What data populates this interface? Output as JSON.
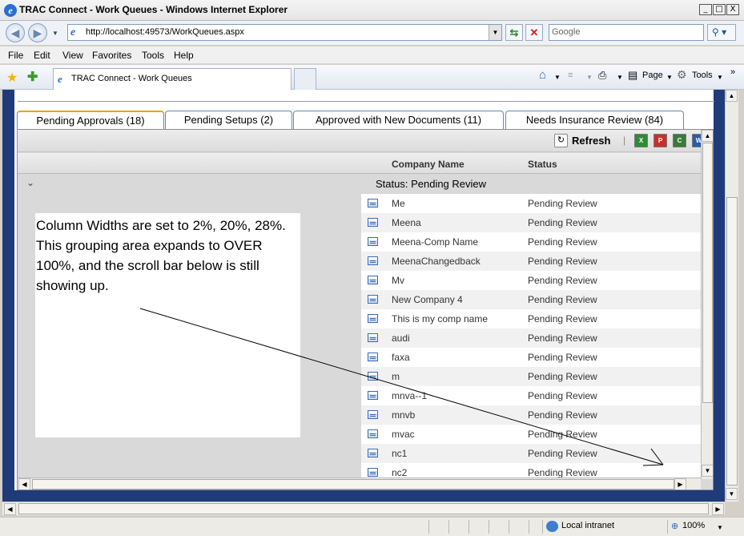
{
  "window": {
    "title": "TRAC Connect - Work Queues - Windows Internet Explorer",
    "controls": [
      "_",
      "□",
      "X"
    ]
  },
  "address_bar": {
    "url": "http://localhost:49573/WorkQueues.aspx",
    "search_placeholder": "Google"
  },
  "menu": [
    "File",
    "Edit",
    "View",
    "Favorites",
    "Tools",
    "Help"
  ],
  "browser_tab": {
    "label": "TRAC Connect - Work Queues"
  },
  "command_bar": {
    "page_label": "Page",
    "tools_label": "Tools"
  },
  "app_tabs": [
    {
      "label": "Pending Approvals (18)",
      "active": true
    },
    {
      "label": "Pending Setups (2)",
      "active": false
    },
    {
      "label": "Approved with New Documents (11)",
      "active": false
    },
    {
      "label": "Needs Insurance Review (84)",
      "active": false
    }
  ],
  "grid": {
    "refresh_label": "Refresh",
    "exports": [
      "excel-icon",
      "pdf-icon",
      "csv-icon",
      "word-icon"
    ],
    "columns": [
      "Company Name",
      "Status"
    ],
    "group_label": "Status: Pending Review",
    "rows": [
      {
        "company": "Me",
        "status": "Pending Review"
      },
      {
        "company": "Meena",
        "status": "Pending Review"
      },
      {
        "company": "Meena-Comp Name",
        "status": "Pending Review"
      },
      {
        "company": "MeenaChangedback",
        "status": "Pending Review"
      },
      {
        "company": "Mv",
        "status": "Pending Review"
      },
      {
        "company": "New Company 4",
        "status": "Pending Review"
      },
      {
        "company": "This is my comp name",
        "status": "Pending Review"
      },
      {
        "company": "audi",
        "status": "Pending Review"
      },
      {
        "company": "faxa",
        "status": "Pending Review"
      },
      {
        "company": "m",
        "status": "Pending Review"
      },
      {
        "company": "mnva--1",
        "status": "Pending Review"
      },
      {
        "company": "mnvb",
        "status": "Pending Review"
      },
      {
        "company": "mvac",
        "status": "Pending Review"
      },
      {
        "company": "nc1",
        "status": "Pending Review"
      },
      {
        "company": "nc2",
        "status": "Pending Review"
      }
    ]
  },
  "annotation": {
    "text": "Column Widths are set to 2%, 20%, 28%.  This grouping area expands to OVER 100%, and the scroll bar below is still showing up."
  },
  "status_bar": {
    "zone": "Local intranet",
    "zoom": "100%"
  }
}
